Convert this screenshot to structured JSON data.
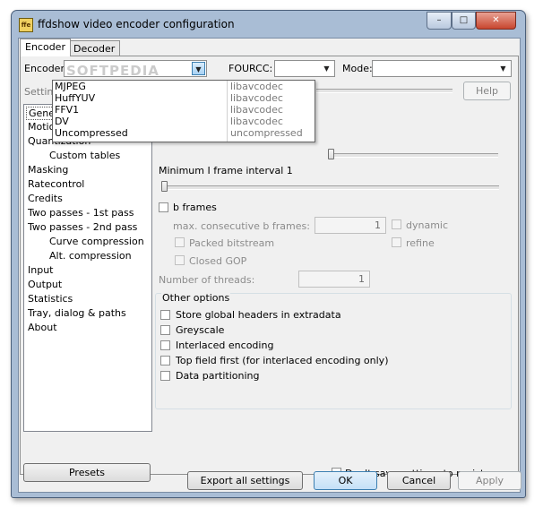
{
  "window": {
    "title": "ffdshow video encoder configuration",
    "icon_text": "ffe",
    "minimize": "–",
    "maximize": "□",
    "close": "✕"
  },
  "tabs": [
    {
      "label": "Encoder",
      "active": true
    },
    {
      "label": "Decoder",
      "active": false
    }
  ],
  "toolbar": {
    "encoder_label": "Encoder:",
    "encoder_value": "",
    "fourcc_label": "FOURCC:",
    "fourcc_value": "",
    "mode_label": "Mode:",
    "mode_value": "",
    "settings_label": "Settings",
    "help_button": "Help"
  },
  "watermark": "SOFTPEDIA",
  "encoder_dropdown": [
    {
      "name": "MJPEG",
      "lib": "libavcodec"
    },
    {
      "name": "HuffYUV",
      "lib": "libavcodec"
    },
    {
      "name": "FFV1",
      "lib": "libavcodec"
    },
    {
      "name": "DV",
      "lib": "libavcodec"
    },
    {
      "name": "Uncompressed",
      "lib": "uncompressed"
    }
  ],
  "tree": [
    {
      "label": "Generic",
      "sub": false,
      "selected": true
    },
    {
      "label": "Motion e",
      "sub": false
    },
    {
      "label": "Quantization",
      "sub": false
    },
    {
      "label": "Custom tables",
      "sub": true
    },
    {
      "label": "Masking",
      "sub": false
    },
    {
      "label": "Ratecontrol",
      "sub": false
    },
    {
      "label": "Credits",
      "sub": false
    },
    {
      "label": "Two passes - 1st pass",
      "sub": false
    },
    {
      "label": "Two passes - 2nd pass",
      "sub": false
    },
    {
      "label": "Curve compression",
      "sub": true
    },
    {
      "label": "Alt. compression",
      "sub": true
    },
    {
      "label": "Input",
      "sub": false
    },
    {
      "label": "Output",
      "sub": false
    },
    {
      "label": "Statistics",
      "sub": false
    },
    {
      "label": "Tray, dialog & paths",
      "sub": false
    },
    {
      "label": "About",
      "sub": false
    }
  ],
  "generic": {
    "min_i_frame_label": "Minimum I frame interval 1",
    "b_frames_label": "b frames",
    "max_b_frames_label": "max. consecutive b frames:",
    "max_b_frames_value": "1",
    "dynamic_label": "dynamic",
    "packed_label": "Packed bitstream",
    "refine_label": "refine",
    "closed_gop_label": "Closed GOP",
    "threads_label": "Number of threads:",
    "threads_value": "1",
    "other_options_label": "Other options",
    "options": [
      "Store global headers in extradata",
      "Greyscale",
      "Interlaced encoding",
      "Top field first (for interlaced encoding only)",
      "Data partitioning"
    ]
  },
  "bottom": {
    "presets_button": "Presets",
    "dont_save_label": "Don't save settings to registry",
    "export_button": "Export all settings",
    "ok_button": "OK",
    "cancel_button": "Cancel",
    "apply_button": "Apply"
  }
}
